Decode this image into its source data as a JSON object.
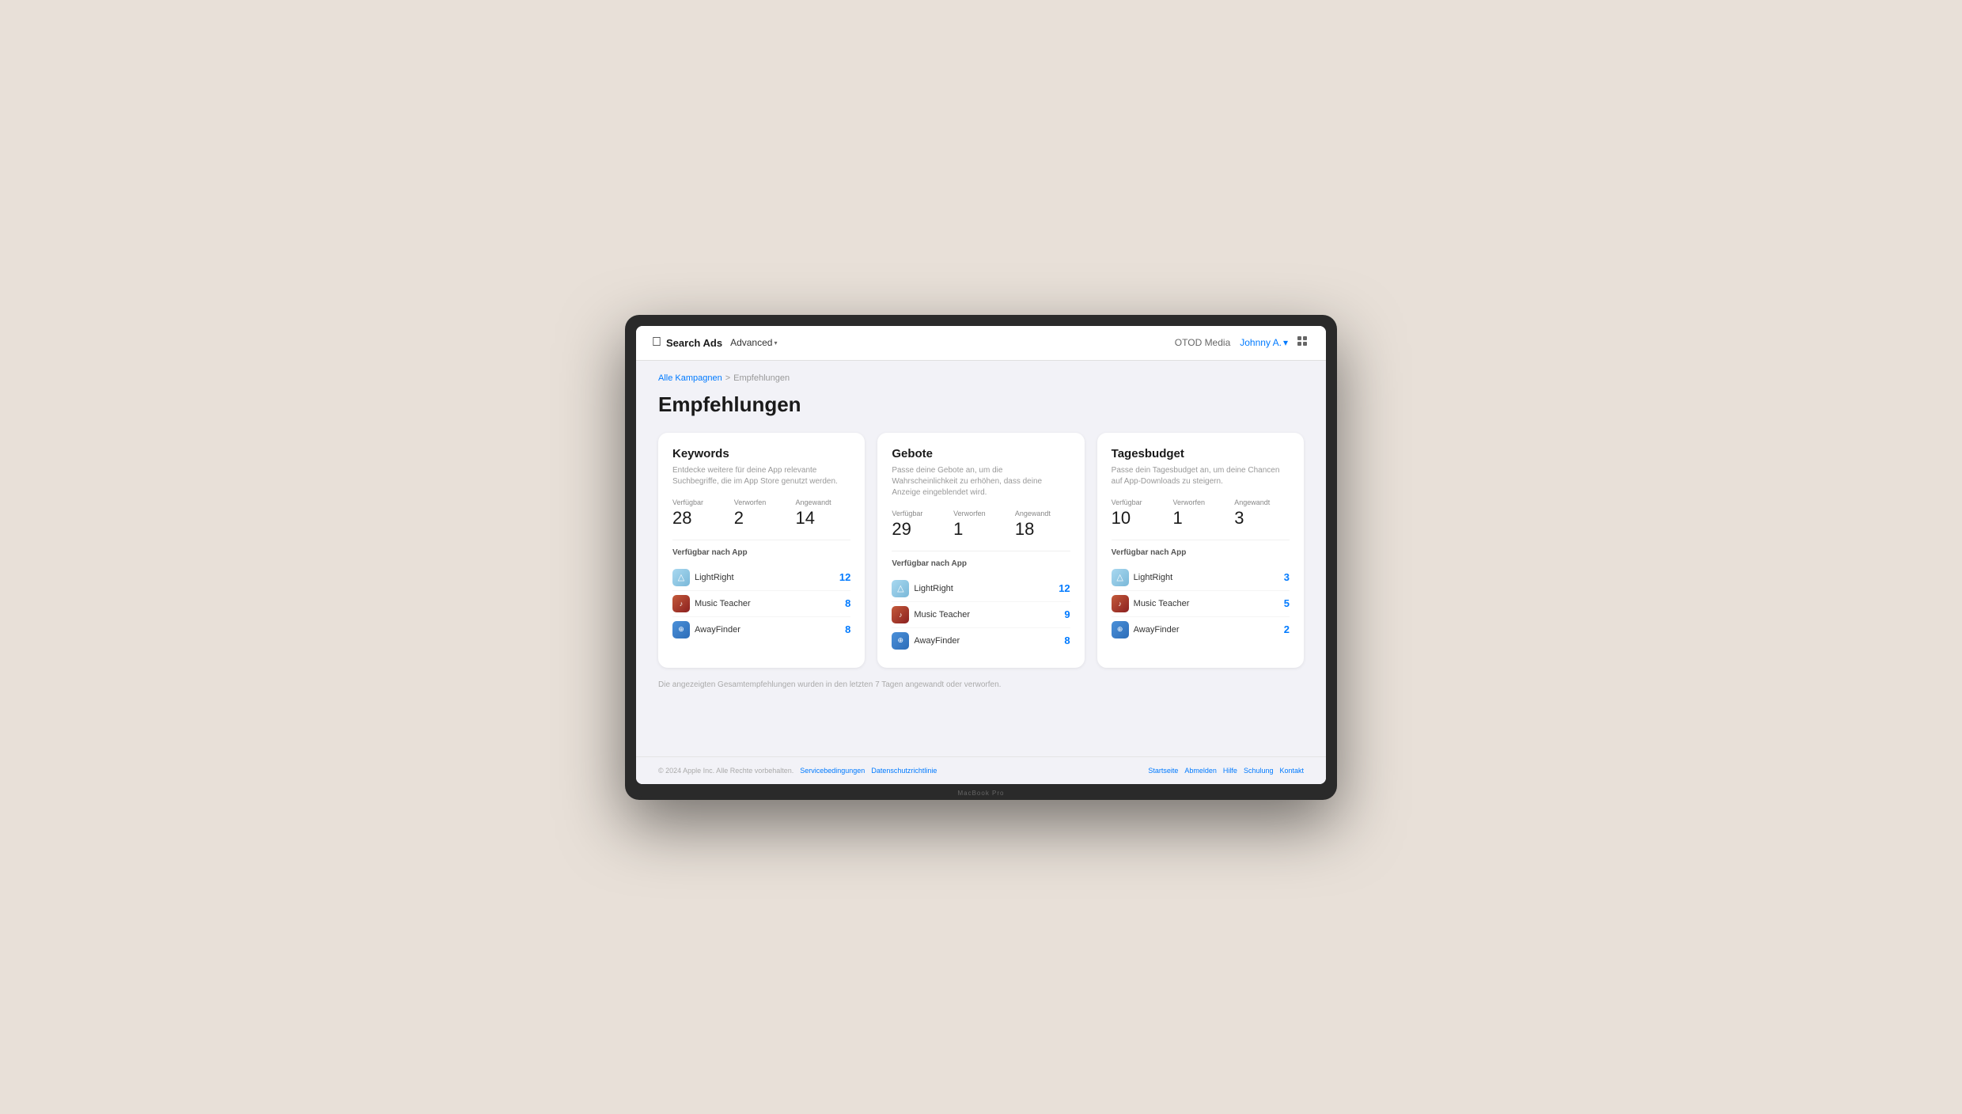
{
  "navbar": {
    "logo": "🍎",
    "brand": "Search Ads",
    "mode": "Advanced",
    "mode_chevron": "▾",
    "org": "OTOD Media",
    "user": "Johnny A.",
    "user_chevron": "▾"
  },
  "breadcrumb": {
    "parent": "Alle Kampagnen",
    "separator": ">",
    "current": "Empfehlungen"
  },
  "page": {
    "title": "Empfehlungen"
  },
  "cards": [
    {
      "id": "keywords",
      "title": "Keywords",
      "desc": "Entdecke weitere für deine App relevante Suchbegriffe, die im App Store genutzt werden.",
      "stats": [
        {
          "label": "Verfügbar",
          "value": "28"
        },
        {
          "label": "Verworfen",
          "value": "2"
        },
        {
          "label": "Angewandt",
          "value": "14"
        }
      ],
      "section_label": "Verfügbar nach App",
      "apps": [
        {
          "name": "LightRight",
          "icon_type": "lightright",
          "icon_char": "△",
          "count": "12"
        },
        {
          "name": "Music Teacher",
          "icon_type": "musicteacher",
          "icon_char": "♪",
          "count": "8"
        },
        {
          "name": "AwayFinder",
          "icon_type": "awayfinder",
          "icon_char": "⊕",
          "count": "8"
        }
      ]
    },
    {
      "id": "gebote",
      "title": "Gebote",
      "desc": "Passe deine Gebote an, um die Wahrscheinlichkeit zu erhöhen, dass deine Anzeige eingeblendet wird.",
      "stats": [
        {
          "label": "Verfügbar",
          "value": "29"
        },
        {
          "label": "Verworfen",
          "value": "1"
        },
        {
          "label": "Angewandt",
          "value": "18"
        }
      ],
      "section_label": "Verfügbar nach App",
      "apps": [
        {
          "name": "LightRight",
          "icon_type": "lightright",
          "icon_char": "△",
          "count": "12"
        },
        {
          "name": "Music Teacher",
          "icon_type": "musicteacher",
          "icon_char": "♪",
          "count": "9"
        },
        {
          "name": "AwayFinder",
          "icon_type": "awayfinder",
          "icon_char": "⊕",
          "count": "8"
        }
      ]
    },
    {
      "id": "tagesbudget",
      "title": "Tagesbudget",
      "desc": "Passe dein Tagesbudget an, um deine Chancen auf App-Downloads zu steigern.",
      "stats": [
        {
          "label": "Verfügbar",
          "value": "10"
        },
        {
          "label": "Verworfen",
          "value": "1"
        },
        {
          "label": "Angewandt",
          "value": "3"
        }
      ],
      "section_label": "Verfügbar nach App",
      "apps": [
        {
          "name": "LightRight",
          "icon_type": "lightright",
          "icon_char": "△",
          "count": "3"
        },
        {
          "name": "Music Teacher",
          "icon_type": "musicteacher",
          "icon_char": "♪",
          "count": "5"
        },
        {
          "name": "AwayFinder",
          "icon_type": "awayfinder",
          "icon_char": "⊕",
          "count": "2"
        }
      ]
    }
  ],
  "footer_note": "Die angezeigten Gesamtempfehlungen wurden in den letzten 7 Tagen angewandt oder verworfen.",
  "footer": {
    "copyright": "© 2024 Apple Inc. Alle Rechte vorbehalten.",
    "links": [
      "Servicebedingungen",
      "Datenschutzrichtlinie"
    ],
    "nav_links": [
      "Startseite",
      "Abmelden",
      "Hilfe",
      "Schulung",
      "Kontakt"
    ]
  }
}
